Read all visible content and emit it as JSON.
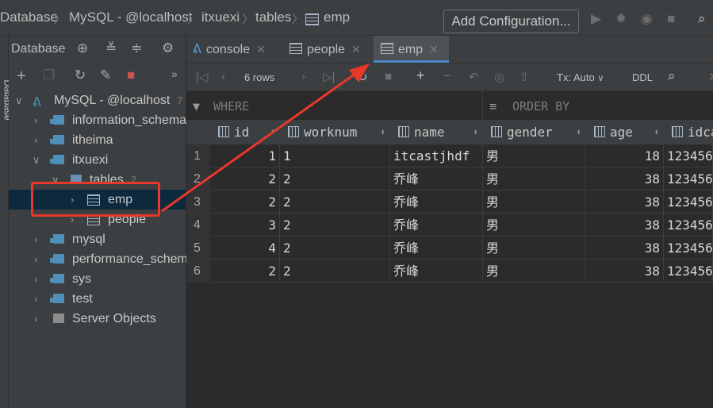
{
  "breadcrumb": [
    "Database",
    "MySQL - @localhost",
    "itxuexi",
    "tables",
    "emp"
  ],
  "toolbar": {
    "add_configuration": "Add Configuration..."
  },
  "left_strip": {
    "label": "Database"
  },
  "left_panel": {
    "title": "Database",
    "tree": [
      {
        "label": "MySQL - @localhost",
        "badge": "7"
      },
      {
        "label": "information_schema"
      },
      {
        "label": "itheima"
      },
      {
        "label": "itxuexi"
      },
      {
        "label": "tables",
        "badge": "2"
      },
      {
        "label": "emp"
      },
      {
        "label": "people"
      },
      {
        "label": "mysql"
      },
      {
        "label": "performance_schema"
      },
      {
        "label": "sys"
      },
      {
        "label": "test"
      },
      {
        "label": "Server Objects"
      }
    ]
  },
  "tabs": [
    {
      "label": "console",
      "active": false
    },
    {
      "label": "people",
      "active": false
    },
    {
      "label": "emp",
      "active": true
    }
  ],
  "grid_toolbar": {
    "rows_label": "6 rows",
    "tx_label": "Tx: Auto",
    "ddl_label": "DDL"
  },
  "filter": {
    "where_label": "WHERE",
    "order_by_label": "ORDER BY"
  },
  "table": {
    "columns": [
      "id",
      "worknum",
      "name",
      "gender",
      "age",
      "idca"
    ],
    "rows": [
      [
        "1",
        "1",
        "itcastjhdf",
        "男",
        "18",
        "123456"
      ],
      [
        "2",
        "2",
        "乔峰",
        "男",
        "38",
        "123456"
      ],
      [
        "2",
        "2",
        "乔峰",
        "男",
        "38",
        "123456"
      ],
      [
        "3",
        "2",
        "乔峰",
        "男",
        "38",
        "123456"
      ],
      [
        "4",
        "2",
        "乔峰",
        "男",
        "38",
        "123456"
      ],
      [
        "2",
        "2",
        "乔峰",
        "男",
        "38",
        "123456"
      ]
    ],
    "row_numbers": [
      "1",
      "2",
      "3",
      "4",
      "5",
      "6"
    ]
  },
  "colors": {
    "highlight": "#e8382a",
    "accent": "#4a88c7",
    "background": "#2b2b2b"
  }
}
